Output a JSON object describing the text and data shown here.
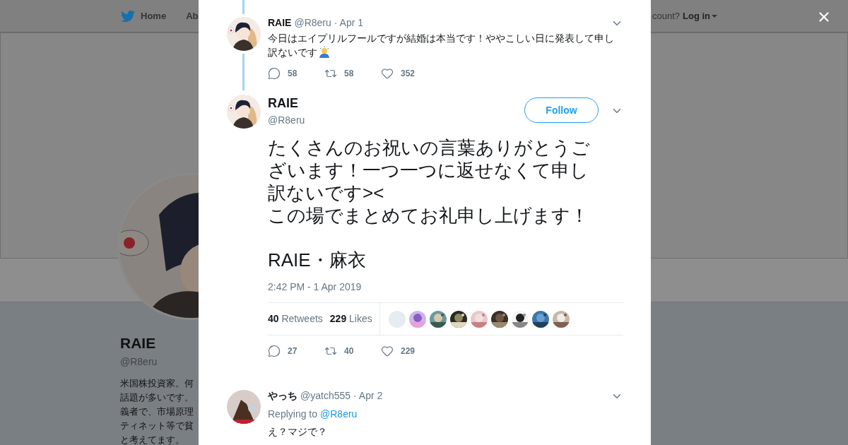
{
  "nav": {
    "home": "Home",
    "about": "Ab",
    "account_prompt": "count?",
    "login": "Log in"
  },
  "profile": {
    "name": "RAIE",
    "handle": "@R8eru",
    "bio_lines": [
      "米国株投資家。何",
      "話題が多いです。",
      "義者で、市場原理",
      "ティネット等で貧",
      "と考えてます。"
    ]
  },
  "parent_tweet": {
    "name": "RAIE",
    "handle": "@R8eru",
    "date": "· Apr 1",
    "text_lines": [
      "今日はエイプリルフールですが結婚は本当です！ややこしい日に発表して申し",
      "訳ないです"
    ],
    "replies": "58",
    "retweets": "58",
    "likes": "352"
  },
  "main_tweet": {
    "name": "RAIE",
    "handle": "@R8eru",
    "follow": "Follow",
    "paragraphs": [
      [
        "たくさんのお祝いの言葉ありがとうご",
        "ざいます！一つ一つに返せなくて申し",
        "訳ないです><",
        "この場でまとめてお礼申し上げます！"
      ],
      [
        "RAIE・麻衣"
      ]
    ],
    "timestamp": "2:42 PM - 1 Apr 2019",
    "retweet_count": "40",
    "retweet_label": "Retweets",
    "like_count": "229",
    "like_label": "Likes",
    "liked_by": [
      {
        "kind": "blank"
      },
      {
        "kind": "picture"
      },
      {
        "kind": "picture"
      },
      {
        "kind": "picture"
      },
      {
        "kind": "picture"
      },
      {
        "kind": "picture"
      },
      {
        "kind": "picture"
      },
      {
        "kind": "picture"
      },
      {
        "kind": "picture"
      }
    ],
    "replies": "27",
    "retweets": "40",
    "likes": "229"
  },
  "replies": [
    {
      "name": "やっち",
      "handle": "@yatch555",
      "date": "· Apr 2",
      "replying_to": "Replying to",
      "mention": "@R8eru",
      "text": "え？マジで？"
    }
  ]
}
